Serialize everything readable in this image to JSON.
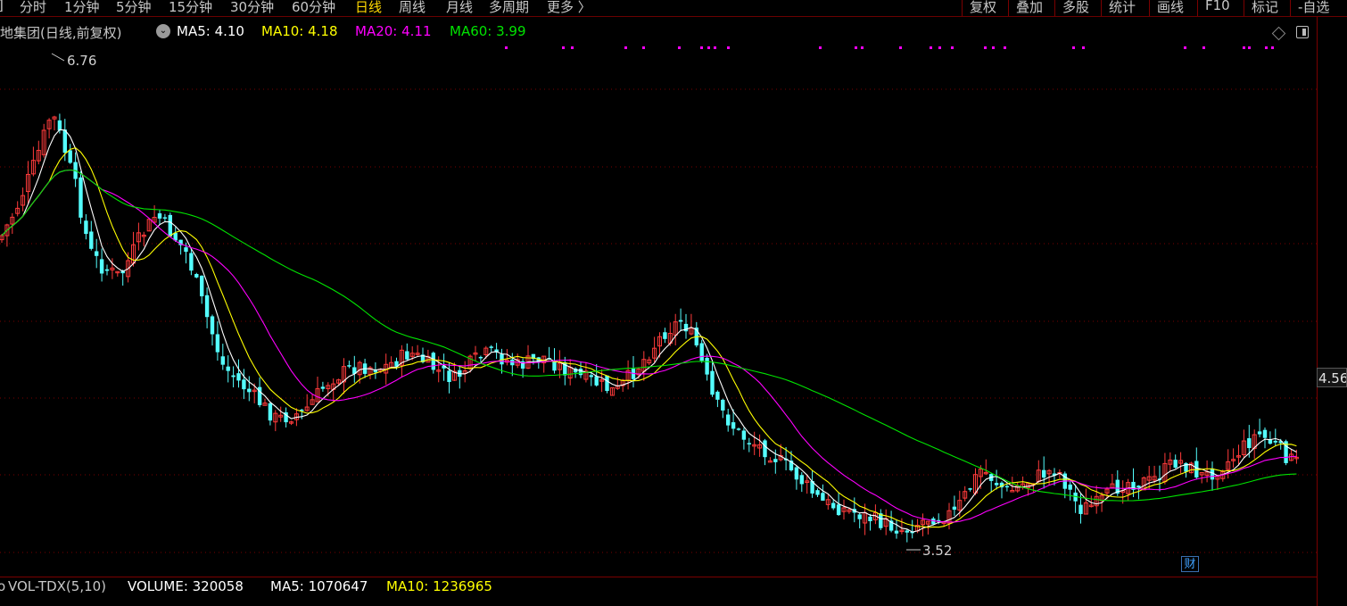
{
  "toolbar": {
    "periods": [
      {
        "label": "分时",
        "active": false
      },
      {
        "label": "1分钟",
        "active": false
      },
      {
        "label": "5分钟",
        "active": false
      },
      {
        "label": "15分钟",
        "active": false
      },
      {
        "label": "30分钟",
        "active": false
      },
      {
        "label": "60分钟",
        "active": false
      },
      {
        "label": "日线",
        "active": true
      },
      {
        "label": "周线",
        "active": false
      },
      {
        "label": "月线",
        "active": false
      },
      {
        "label": "多周期",
        "active": false
      },
      {
        "label": "更多 〉",
        "active": false
      }
    ],
    "tools": [
      "复权",
      "叠加",
      "多股",
      "统计",
      "画线",
      "F10",
      "标记",
      "-自选"
    ]
  },
  "info": {
    "title": "地集团(日线,前复权)",
    "ma5": "MA5: 4.10",
    "ma10": "MA10: 4.18",
    "ma20": "MA20: 4.11",
    "ma60": "MA60: 3.99"
  },
  "volume": {
    "label": "VOL-TDX(5,10)",
    "volume": "VOLUME: 320058",
    "ma5": "MA5: 1070647",
    "ma10": "MA10: 1236965"
  },
  "annotations": {
    "high": "6.76",
    "low": "3.52",
    "current_price_tag": "4.56",
    "cai_badge": "财"
  },
  "colors": {
    "up": "#ff3b3b",
    "down": "#54ffff",
    "ma5": "#ffffff",
    "ma10": "#ffff00",
    "ma20": "#ff00ff",
    "ma60": "#00e400",
    "grid": "#7a0000",
    "active_tab": "#ffd800"
  }
}
